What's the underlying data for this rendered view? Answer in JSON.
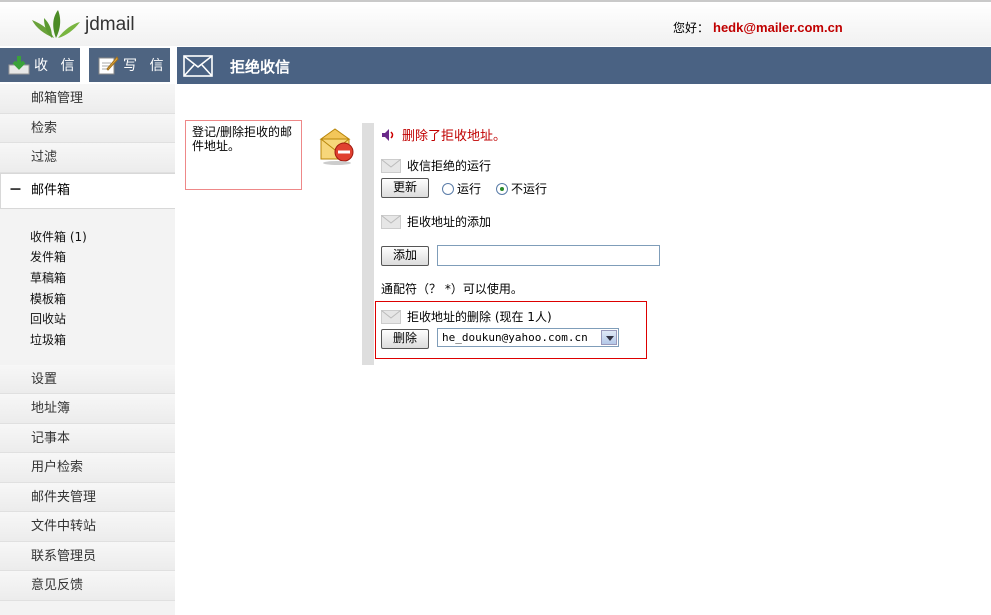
{
  "app": {
    "name": "jdmail"
  },
  "topbar": {
    "greeting": "您好：",
    "user_email": "hedk@mailer.com.cn"
  },
  "toolbar": {
    "inbox_label": "收 信",
    "write_label": "写 信"
  },
  "header": {
    "title": "拒绝收信"
  },
  "sidebar": {
    "items_top": [
      "邮箱管理",
      "检索",
      "过滤"
    ],
    "mailbox": {
      "expand": "－",
      "label": "邮件箱"
    },
    "folders": [
      "收件箱 (1)",
      "发件箱",
      "草稿箱",
      "模板箱",
      "回收站",
      "垃圾箱"
    ],
    "items_bottom": [
      "设置",
      "地址簿",
      "记事本",
      "用户检索",
      "邮件夹管理",
      "文件中转站",
      "联系管理员",
      "意见反馈"
    ]
  },
  "main": {
    "description": "登记/删除拒收的邮件地址。",
    "message": "删除了拒收地址。",
    "run_section": {
      "title": "收信拒绝的运行",
      "update_label": "更新",
      "options": [
        "运行",
        "不运行"
      ],
      "selected": "不运行"
    },
    "add_section": {
      "title": "拒收地址的添加",
      "add_label": "添加",
      "input_value": ""
    },
    "note": "通配符（？ *）可以使用。",
    "delete_section": {
      "title": "拒收地址的删除 (现在 1人)",
      "delete_label": "删除",
      "selected_address": "he_doukun@yahoo.com.cn"
    }
  },
  "colors": {
    "header_bg": "#4a6283",
    "accent_red": "#c00000"
  }
}
